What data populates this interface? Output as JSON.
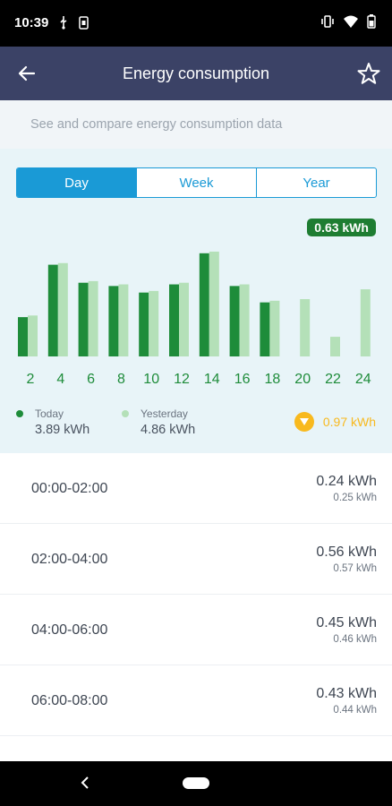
{
  "status_bar": {
    "time": "10:39"
  },
  "app_bar": {
    "title": "Energy consumption"
  },
  "subtitle": "See and compare energy consumption data",
  "tabs": [
    {
      "label": "Day",
      "active": true
    },
    {
      "label": "Week",
      "active": false
    },
    {
      "label": "Year",
      "active": false
    }
  ],
  "total_badge": "0.63 kWh",
  "colors": {
    "today": "#1e8c3a",
    "yesterday": "#b4e0b8",
    "accent": "#1a9ad6",
    "app_bar": "#3b4266",
    "warning": "#f8b91e"
  },
  "chart_data": {
    "type": "bar",
    "categories": [
      "2",
      "4",
      "6",
      "8",
      "10",
      "12",
      "14",
      "16",
      "18",
      "20",
      "22",
      "24"
    ],
    "series": [
      {
        "name": "Today",
        "values": [
          0.24,
          0.56,
          0.45,
          0.43,
          0.39,
          0.44,
          0.63,
          0.43,
          0.33,
          null,
          null,
          null
        ]
      },
      {
        "name": "Yesterday",
        "values": [
          0.25,
          0.57,
          0.46,
          0.44,
          0.4,
          0.45,
          0.64,
          0.44,
          0.34,
          0.35,
          0.12,
          0.41
        ]
      }
    ],
    "ylim": [
      0,
      0.7
    ]
  },
  "legend": {
    "today": {
      "label": "Today",
      "value": "3.89 kWh"
    },
    "yesterday": {
      "label": "Yesterday",
      "value": "4.86 kWh"
    },
    "difference": "0.97 kWh"
  },
  "rows": [
    {
      "range": "00:00-02:00",
      "today": "0.24 kWh",
      "yesterday": "0.25 kWh"
    },
    {
      "range": "02:00-04:00",
      "today": "0.56 kWh",
      "yesterday": "0.57 kWh"
    },
    {
      "range": "04:00-06:00",
      "today": "0.45 kWh",
      "yesterday": "0.46 kWh"
    },
    {
      "range": "06:00-08:00",
      "today": "0.43 kWh",
      "yesterday": "0.44 kWh"
    }
  ]
}
